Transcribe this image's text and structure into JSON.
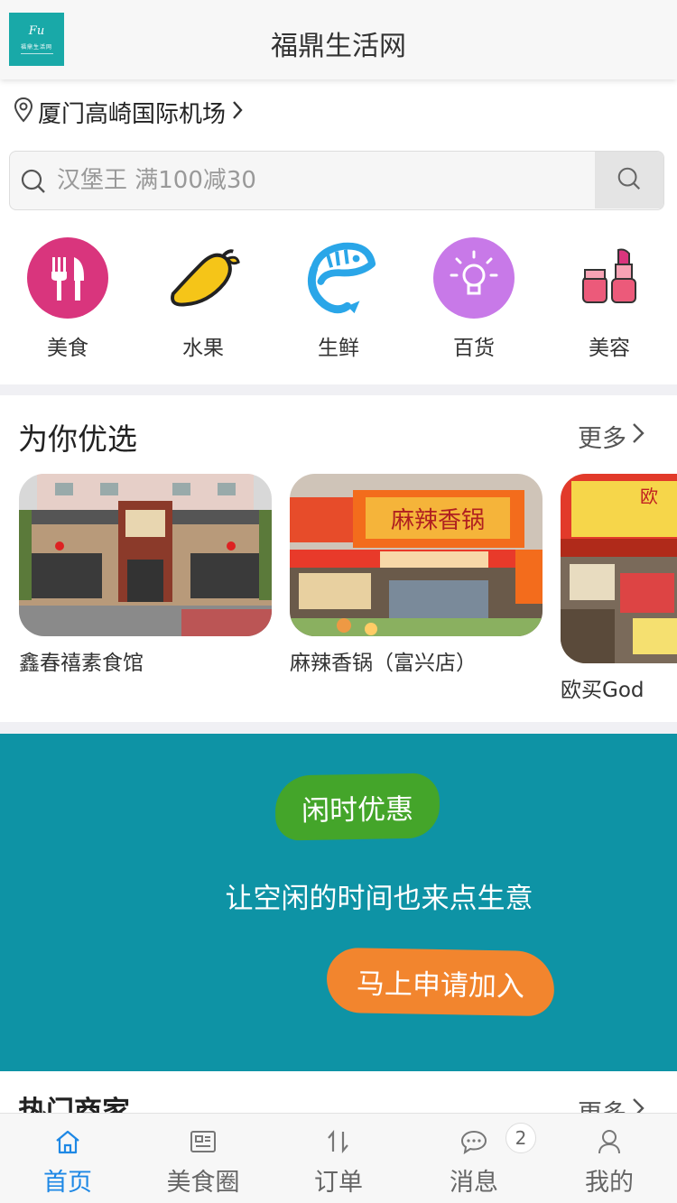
{
  "header": {
    "title": "福鼎生活网",
    "logo_mark": "Fu",
    "logo_name": "福鼎生活网"
  },
  "location": {
    "text": "厦门高崎国际机场",
    "icon": "location-pin-icon"
  },
  "search": {
    "placeholder": "汉堡王 满100减30",
    "icon": "search-icon"
  },
  "categories": [
    {
      "label": "美食",
      "icon": "fork-knife-icon",
      "color": "#d9357d"
    },
    {
      "label": "水果",
      "icon": "mango-icon",
      "color": "#f5c518"
    },
    {
      "label": "生鲜",
      "icon": "shrimp-icon",
      "color": "#2aa6e8"
    },
    {
      "label": "百货",
      "icon": "lightbulb-icon",
      "color": "#c879e8"
    },
    {
      "label": "美容",
      "icon": "lipstick-icon",
      "color": "#ec5a7a"
    }
  ],
  "recommended": {
    "title": "为你优选",
    "more": "更多",
    "items": [
      {
        "name": "鑫春禧素食馆"
      },
      {
        "name": "麻辣香锅（富兴店）",
        "sign": "麻辣香锅"
      },
      {
        "name": "欧买God",
        "sign": "欧"
      }
    ]
  },
  "banner": {
    "badge": "闲时优惠",
    "tagline": "让空闲的时间也来点生意",
    "cta": "马上申请加入",
    "bg_color": "#0e93a5",
    "badge_color": "#44a52a",
    "cta_color": "#f2852e"
  },
  "hot": {
    "title": "热门商家",
    "more": "更多"
  },
  "tabbar": {
    "tabs": [
      {
        "label": "首页",
        "icon": "home-icon",
        "active": true
      },
      {
        "label": "美食圈",
        "icon": "news-icon"
      },
      {
        "label": "订单",
        "icon": "sort-icon"
      },
      {
        "label": "消息",
        "icon": "chat-icon",
        "badge": "2"
      },
      {
        "label": "我的",
        "icon": "user-icon"
      }
    ],
    "active_color": "#1e88e5"
  }
}
